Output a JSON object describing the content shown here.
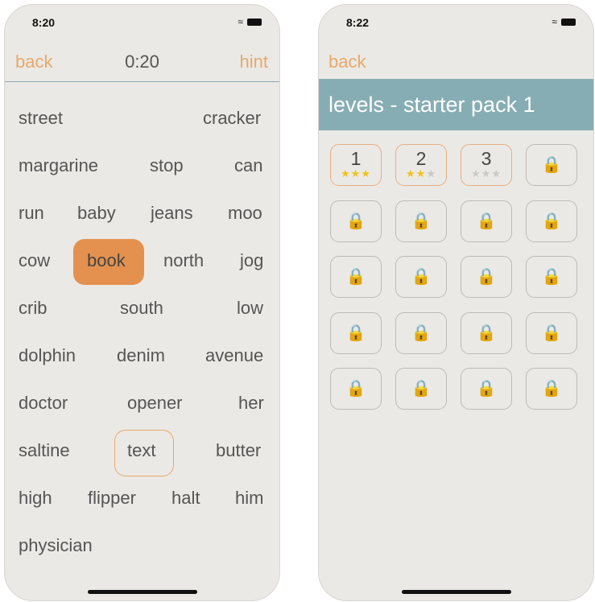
{
  "game_screen": {
    "status_time": "8:20",
    "back": "back",
    "timer": "0:20",
    "hint": "hint",
    "rows": [
      [
        "street",
        "cracker"
      ],
      [
        "margarine",
        "stop",
        "can"
      ],
      [
        "run",
        "baby",
        "jeans",
        "moo"
      ],
      [
        "cow",
        "book",
        "north",
        "jog"
      ],
      [
        "crib",
        "south",
        "low"
      ],
      [
        "dolphin",
        "denim",
        "avenue"
      ],
      [
        "doctor",
        "opener",
        "her"
      ],
      [
        "saltine",
        "text",
        "butter"
      ],
      [
        "high",
        "flipper",
        "halt",
        "him"
      ],
      [
        "physician"
      ]
    ],
    "selected_word": "book",
    "outlined_word": "text"
  },
  "levels_screen": {
    "status_time": "8:22",
    "back": "back",
    "title": "levels - starter pack 1",
    "levels": [
      {
        "number": "1",
        "stars": 3
      },
      {
        "number": "2",
        "stars": 2
      },
      {
        "number": "3",
        "stars": 0
      }
    ],
    "locked_count": 17,
    "lock_icon": "lock-icon"
  },
  "colors": {
    "accent": "#e8a96a",
    "selected": "#e4914f",
    "banner": "#86adb4",
    "star": "#f3c21a"
  }
}
